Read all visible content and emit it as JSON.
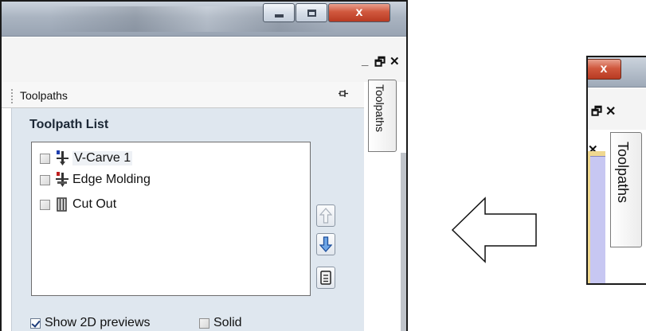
{
  "left_window": {
    "caption_buttons": {
      "close_glyph": "x"
    },
    "panel_controls": {
      "minimize_glyph": "_",
      "restore_glyph": "🗗",
      "close_glyph": "✕"
    },
    "panel": {
      "title": "Toolpaths",
      "side_tab_label": "Toolpaths",
      "list_title": "Toolpath List",
      "items": [
        {
          "label": "V-Carve 1",
          "checked": false,
          "icon": "vcarve-tool-icon",
          "selected": true
        },
        {
          "label": "Edge Molding",
          "checked": false,
          "icon": "edge-molding-tool-icon",
          "selected": false
        },
        {
          "label": "Cut Out",
          "checked": false,
          "icon": "cutout-tool-icon",
          "selected": false
        }
      ],
      "side_buttons": [
        "move-up-icon",
        "move-down-icon",
        "properties-icon"
      ],
      "options": {
        "show_2d_previews_label": "Show 2D previews",
        "show_2d_previews_checked": true,
        "solid_label": "Solid",
        "solid_checked": false
      }
    }
  },
  "arrow": {
    "direction": "left"
  },
  "right_window": {
    "close_glyph": "x",
    "restore_glyph": "🗗",
    "panel_close_glyph": "✕",
    "inner_close_glyph": "✕",
    "side_tab_label": "Toolpaths"
  },
  "colors": {
    "panel_bg": "#dfe7ef",
    "close_button": "#c9482e",
    "vcarve_marker": "#1f3fb0",
    "edge_marker": "#c02020"
  }
}
